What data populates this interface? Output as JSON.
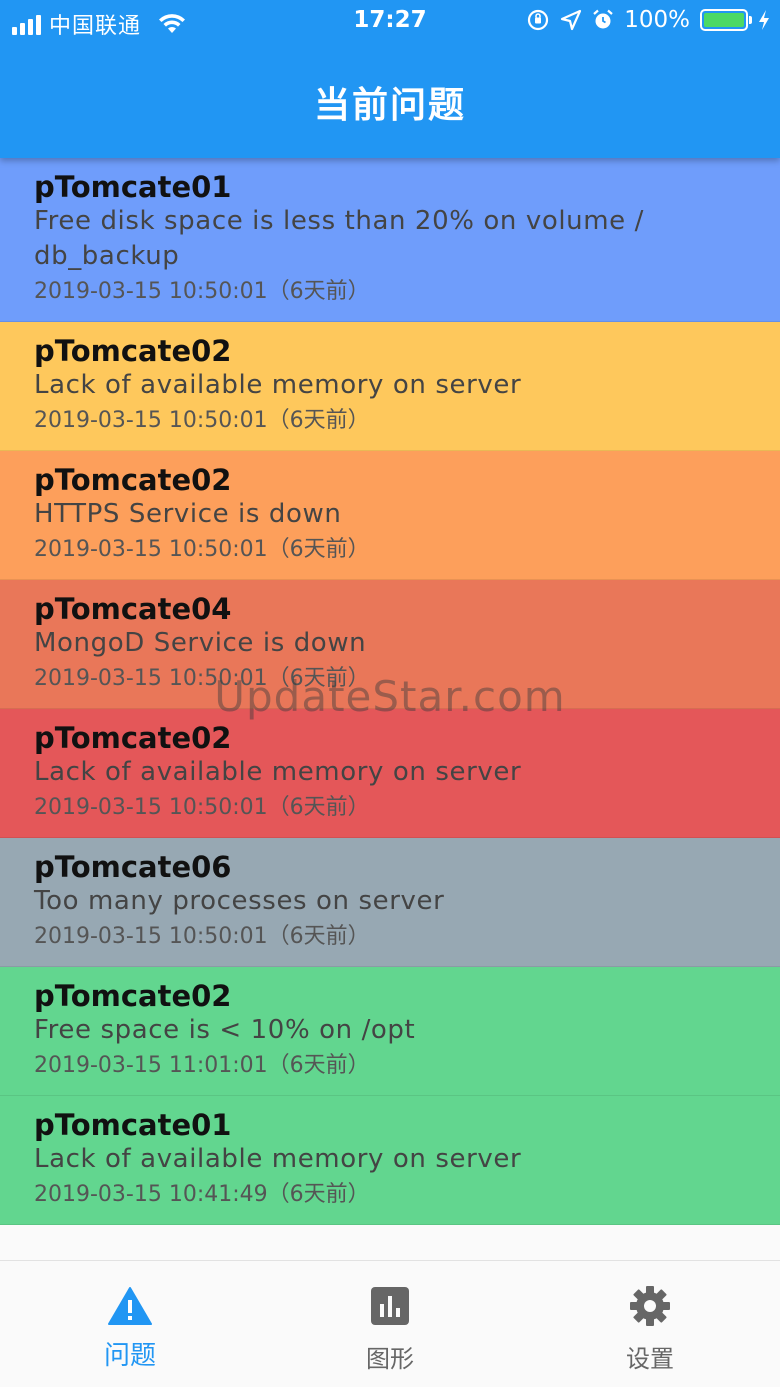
{
  "status_bar": {
    "carrier": "中国联通",
    "time": "17:27",
    "battery": "100%"
  },
  "header": {
    "title": "当前问题"
  },
  "issues": [
    {
      "host": "pTomcate01",
      "message": "Free disk space is less than 20% on volume / db_backup",
      "time": "2019-03-15 10:50:01（6天前）",
      "color": "#6f9dfb"
    },
    {
      "host": "pTomcate02",
      "message": "Lack of available memory on server",
      "time": "2019-03-15 10:50:01（6天前）",
      "color": "#fec85c"
    },
    {
      "host": "pTomcate02",
      "message": "HTTPS Service is down",
      "time": "2019-03-15 10:50:01（6天前）",
      "color": "#fd9f5b"
    },
    {
      "host": "pTomcate04",
      "message": "MongoD Service is down",
      "time": "2019-03-15 10:50:01（6天前）",
      "color": "#e97759"
    },
    {
      "host": "pTomcate02",
      "message": "Lack of available memory on server",
      "time": "2019-03-15 10:50:01（6天前）",
      "color": "#e45759"
    },
    {
      "host": "pTomcate06",
      "message": "Too many processes on server",
      "time": "2019-03-15 10:50:01（6天前）",
      "color": "#97a8b3"
    },
    {
      "host": "pTomcate02",
      "message": "Free space is < 10% on /opt",
      "time": "2019-03-15 11:01:01（6天前）",
      "color": "#62d68f"
    },
    {
      "host": "pTomcate01",
      "message": "Lack of available memory on server",
      "time": "2019-03-15 10:41:49（6天前）",
      "color": "#62d68f"
    }
  ],
  "watermark": "UpdateStar.com",
  "bottom_nav": {
    "tabs": [
      {
        "label": "问题",
        "icon": "warning-icon",
        "active": true
      },
      {
        "label": "图形",
        "icon": "bar-chart-icon",
        "active": false
      },
      {
        "label": "设置",
        "icon": "gear-icon",
        "active": false
      }
    ]
  },
  "colors": {
    "primary": "#2196f3",
    "battery": "#4cd964"
  }
}
